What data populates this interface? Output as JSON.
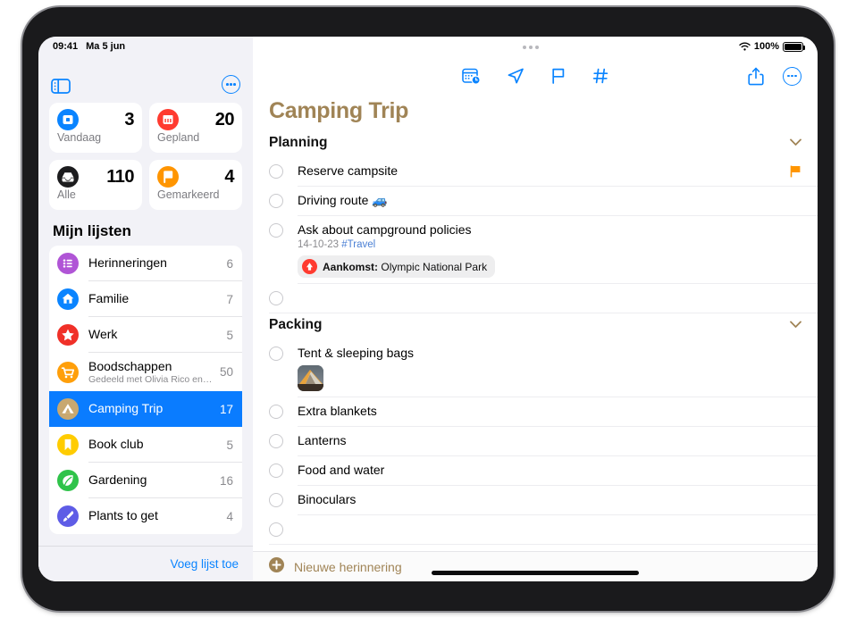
{
  "status_bar": {
    "time": "09:41",
    "date": "Ma 5 jun",
    "battery_percent": "100%",
    "wifi_icon": "wifi-icon",
    "battery_icon": "battery-icon"
  },
  "sidebar": {
    "toggle_icon": "sidebar-toggle-icon",
    "more_icon": "more-options-icon",
    "smart_lists": [
      {
        "label": "Vandaag",
        "count": "3",
        "icon": "today-calendar-icon",
        "color": "#0a84ff"
      },
      {
        "label": "Gepland",
        "count": "20",
        "icon": "scheduled-calendar-icon",
        "color": "#ff3b30"
      },
      {
        "label": "Alle",
        "count": "110",
        "icon": "all-inbox-icon",
        "color": "#1c1c1e"
      },
      {
        "label": "Gemarkeerd",
        "count": "4",
        "icon": "flagged-flag-icon",
        "color": "#ff9500"
      }
    ],
    "my_lists_title": "Mijn lijsten",
    "lists": [
      {
        "name": "Herinneringen",
        "subtitle": "",
        "count": "6",
        "icon": "bullet-list-icon",
        "color": "#b055d6",
        "selected": false
      },
      {
        "name": "Familie",
        "subtitle": "",
        "count": "7",
        "icon": "house-icon",
        "color": "#0a84ff",
        "selected": false
      },
      {
        "name": "Werk",
        "subtitle": "",
        "count": "5",
        "icon": "star-icon",
        "color": "#f03028",
        "selected": false
      },
      {
        "name": "Boodschappen",
        "subtitle": "Gedeeld met Olivia Rico en 3 a...",
        "count": "50",
        "icon": "shopping-cart-icon",
        "color": "#ff9f0a",
        "selected": false
      },
      {
        "name": "Camping Trip",
        "subtitle": "",
        "count": "17",
        "icon": "tent-icon",
        "color": "#c8a870",
        "selected": true
      },
      {
        "name": "Book club",
        "subtitle": "",
        "count": "5",
        "icon": "bookmark-icon",
        "color": "#ffcc00",
        "selected": false
      },
      {
        "name": "Gardening",
        "subtitle": "",
        "count": "16",
        "icon": "leaf-icon",
        "color": "#2fc34a",
        "selected": false
      },
      {
        "name": "Plants to get",
        "subtitle": "",
        "count": "4",
        "icon": "paintbrush-icon",
        "color": "#5e5ce6",
        "selected": false
      }
    ],
    "add_list_label": "Voeg lijst toe"
  },
  "main": {
    "title": "Camping Trip",
    "accent_color": "#a08456",
    "toolbar": {
      "center_icons": [
        {
          "name": "schedule-calendar-icon"
        },
        {
          "name": "location-arrow-icon"
        },
        {
          "name": "flag-outline-icon"
        },
        {
          "name": "hashtag-tag-icon"
        }
      ],
      "share_icon": "share-icon",
      "more_icon": "more-options-icon"
    },
    "sections": [
      {
        "title": "Planning",
        "chevron_icon": "chevron-down-icon",
        "reminders": [
          {
            "title": "Reserve campsite",
            "meta": "",
            "tag": "",
            "flagged": true,
            "flag_icon": "flag-icon",
            "location_badge": null,
            "thumbnail": null
          },
          {
            "title": "Driving route 🚙",
            "meta": "",
            "tag": "",
            "flagged": false,
            "location_badge": null,
            "thumbnail": null
          },
          {
            "title": "Ask about campground policies",
            "meta": "14-10-23",
            "tag": "#Travel",
            "flagged": false,
            "location_badge": {
              "icon": "location-pin-icon",
              "label": "Aankomst:",
              "value": "Olympic National Park"
            },
            "thumbnail": null
          },
          {
            "title": "",
            "meta": "",
            "tag": "",
            "flagged": false,
            "location_badge": null,
            "thumbnail": null
          }
        ]
      },
      {
        "title": "Packing",
        "chevron_icon": "chevron-down-icon",
        "reminders": [
          {
            "title": "Tent & sleeping bags",
            "meta": "",
            "tag": "",
            "flagged": false,
            "location_badge": null,
            "thumbnail": "tent-photo-thumbnail"
          },
          {
            "title": "Extra blankets",
            "meta": "",
            "tag": "",
            "flagged": false,
            "location_badge": null,
            "thumbnail": null
          },
          {
            "title": "Lanterns",
            "meta": "",
            "tag": "",
            "flagged": false,
            "location_badge": null,
            "thumbnail": null
          },
          {
            "title": "Food and water",
            "meta": "",
            "tag": "",
            "flagged": false,
            "location_badge": null,
            "thumbnail": null
          },
          {
            "title": "Binoculars",
            "meta": "",
            "tag": "",
            "flagged": false,
            "location_badge": null,
            "thumbnail": null
          },
          {
            "title": "",
            "meta": "",
            "tag": "",
            "flagged": false,
            "location_badge": null,
            "thumbnail": null
          }
        ]
      }
    ],
    "new_reminder": {
      "label": "Nieuwe herinnering",
      "icon": "plus-circle-icon"
    }
  }
}
